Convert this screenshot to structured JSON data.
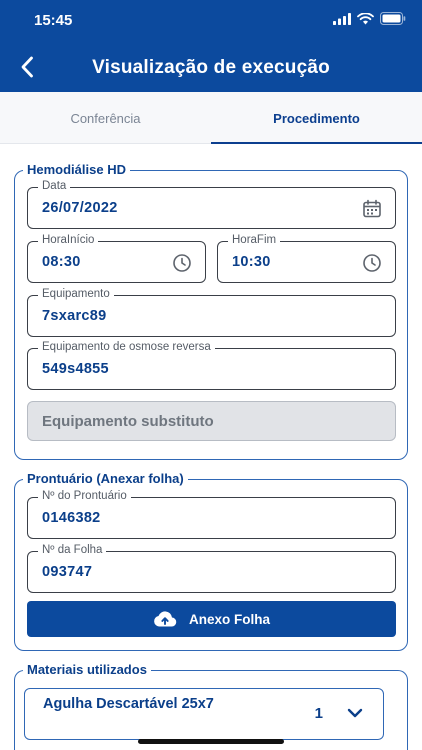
{
  "status_bar": {
    "time": "15:45"
  },
  "header": {
    "title": "Visualização de execução"
  },
  "tabs": [
    {
      "label": "Conferência",
      "active": false
    },
    {
      "label": "Procedimento",
      "active": true
    }
  ],
  "hemodialise": {
    "legend": "Hemodiálise HD",
    "data": {
      "label": "Data",
      "value": "26/07/2022"
    },
    "hora_inicio": {
      "label": "HoraInício",
      "value": "08:30"
    },
    "hora_fim": {
      "label": "HoraFim",
      "value": "10:30"
    },
    "equipamento": {
      "label": "Equipamento",
      "value": "7sxarc89"
    },
    "osmose": {
      "label": "Equipamento de osmose reversa",
      "value": "549s4855"
    },
    "substituto_button": "Equipamento substituto"
  },
  "prontuario": {
    "legend": "Prontuário (Anexar folha)",
    "numero": {
      "label": "Nº do Prontuário",
      "value": "0146382"
    },
    "folha": {
      "label": "Nº da Folha",
      "value": "093747"
    },
    "anexo_button": "Anexo Folha"
  },
  "materiais": {
    "legend": "Materiais utilizados",
    "items": [
      {
        "name": "Agulha Descartável 25x7",
        "quantity": "1"
      }
    ]
  },
  "colors": {
    "primary": "#0c4a9e",
    "text": "#0b3f8a",
    "disabled": "#e1e3e7"
  },
  "icons": [
    "back-arrow-icon",
    "signal-icon",
    "wifi-icon",
    "battery-icon",
    "calendar-icon",
    "clock-icon",
    "cloud-upload-icon",
    "chevron-down-icon"
  ]
}
